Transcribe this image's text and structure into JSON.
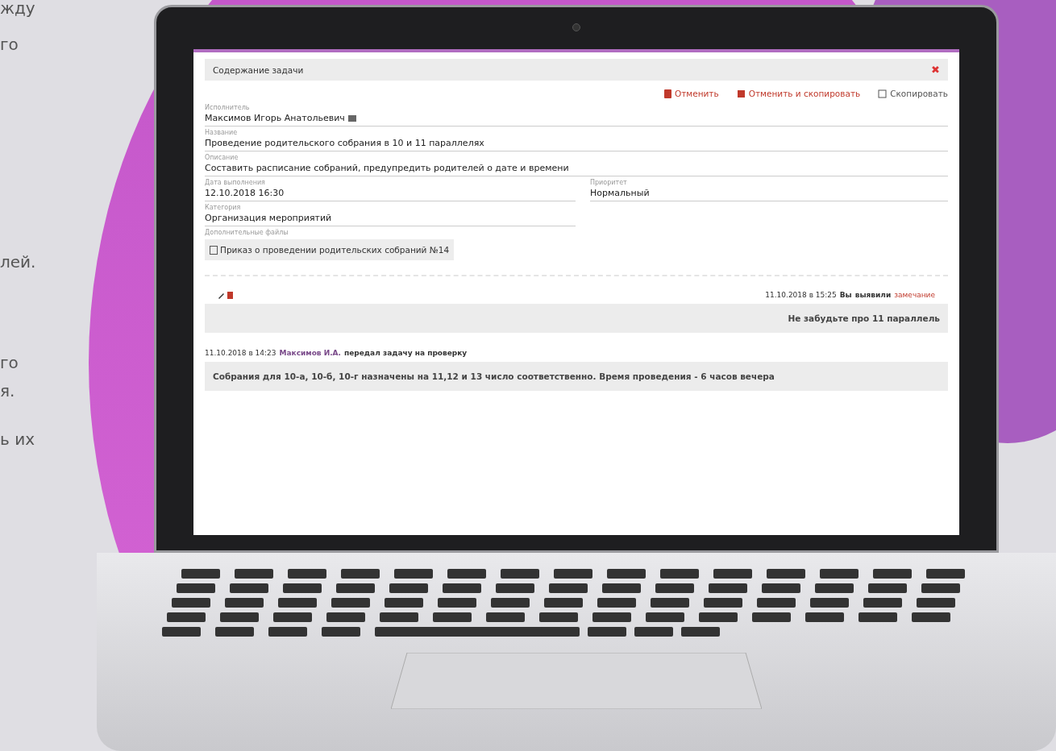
{
  "side_text": [
    "жду",
    "го",
    "лей.",
    "го",
    "я.",
    "ь их"
  ],
  "dialog": {
    "title": "Содержание задачи",
    "close": "✖",
    "actions": [
      {
        "kind": "cancel",
        "label": "Отменить"
      },
      {
        "kind": "cancel-copy",
        "label": "Отменить и скопировать"
      },
      {
        "kind": "copy",
        "label": "Скопировать"
      }
    ],
    "fields": [
      {
        "label": "Исполнитель",
        "value": "Максимов Игорь Анатольевич",
        "kind": "person",
        "half": false
      },
      {
        "label": "Название",
        "value": "Проведение родительского собрания в 10 и 11 параллелях",
        "kind": "line",
        "half": false
      },
      {
        "label": "Описание",
        "value": "Составить расписание собраний, предупредить родителей о дате и времени",
        "kind": "line",
        "half": false
      },
      {
        "label": "Дата выполнения",
        "value": "12.10.2018 16:30",
        "kind": "line",
        "half": true
      },
      {
        "label": "Приоритет",
        "value": "Нормальный",
        "kind": "line",
        "half": true
      },
      {
        "label": "Категория",
        "value": "Организация мероприятий",
        "kind": "line",
        "half": true
      }
    ],
    "files_label": "Дополнительные файлы",
    "files": [
      "Приказ о проведении родительских собраний №14"
    ],
    "history": [
      {
        "kind": "remark",
        "time": "11.10.2018 в 15:25",
        "author": "Вы",
        "action": "выявили",
        "object": "замечание",
        "text": "Не забудьте про 11 параллель"
      },
      {
        "kind": "handover",
        "time": "11.10.2018 в 14:23",
        "author": "Максимов И.А.",
        "action": "передал задачу на проверку",
        "text": "Собрания для 10-а, 10-б, 10-г назначены на 11,12 и 13 число соответственно. Время проведения - 6 часов вечера"
      }
    ]
  }
}
